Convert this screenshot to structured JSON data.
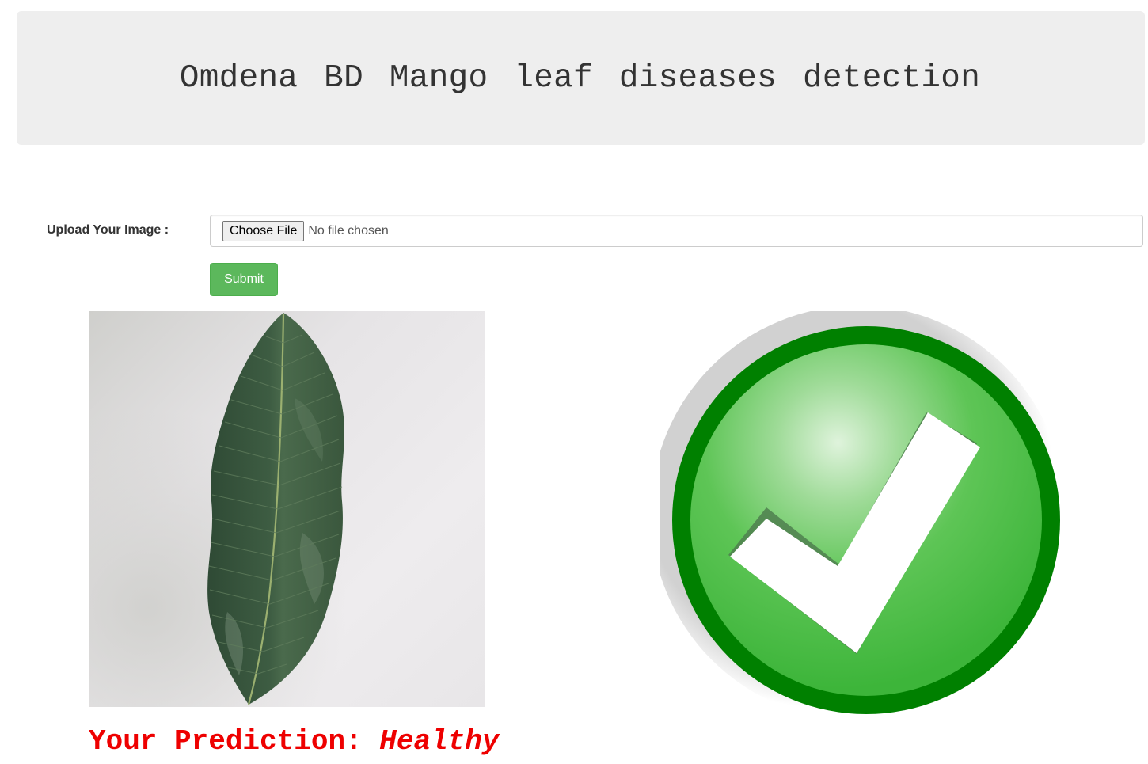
{
  "header": {
    "title": "Omdena BD Mango leaf diseases detection"
  },
  "form": {
    "upload_label": "Upload Your Image :",
    "choose_file_label": "Choose File",
    "file_status": "No file chosen",
    "submit_label": "Submit"
  },
  "result": {
    "prediction_label": "Your Prediction:",
    "prediction_value": "Healthy",
    "status_icon": "check-mark-icon"
  },
  "colors": {
    "jumbotron_bg": "#eeeeee",
    "submit_green": "#5cb85c",
    "prediction_red": "#ee0000",
    "check_green": "#009900"
  }
}
